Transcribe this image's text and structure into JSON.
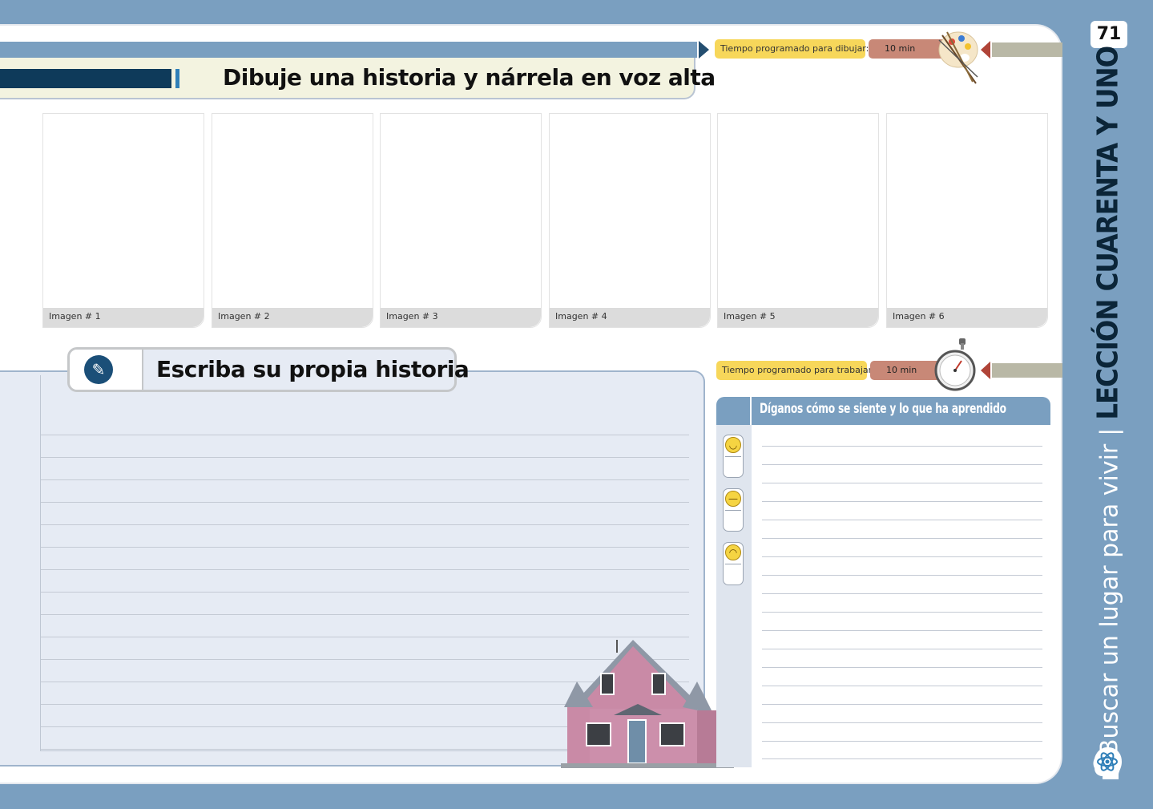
{
  "page_number": "71",
  "section1": {
    "title": "Dibuje una historia y nárrela en voz alta",
    "timer_label": "Tiempo programado para dibujar:",
    "timer_value": "10 min",
    "timer_icon": "paintbrush-palette-icon"
  },
  "panels": [
    {
      "caption": "Imagen # 1"
    },
    {
      "caption": "Imagen # 2"
    },
    {
      "caption": "Imagen # 3"
    },
    {
      "caption": "Imagen # 4"
    },
    {
      "caption": "Imagen # 5"
    },
    {
      "caption": "Imagen # 6"
    }
  ],
  "section2": {
    "title": "Escriba su propia historia",
    "icon": "pen-icon",
    "timer_label": "Tiempo programado para trabajar:",
    "timer_value": "10 min",
    "timer_icon": "stopwatch-icon"
  },
  "feedback": {
    "title": "Díganos cómo se siente y lo que ha aprendido",
    "faces": [
      "happy-face-icon",
      "neutral-face-icon",
      "sad-face-icon"
    ]
  },
  "sidebar": {
    "subtitle": "Buscar un lugar para vivir",
    "separator": "|",
    "lesson": "LECCIÓN CUARENTA Y UNO",
    "icon": "atom-head-icon"
  },
  "colors": {
    "frame_blue": "#7a9fc0",
    "navy": "#0e3a5a",
    "timer_yellow": "#f7d75a",
    "timer_red": "#c88877"
  }
}
